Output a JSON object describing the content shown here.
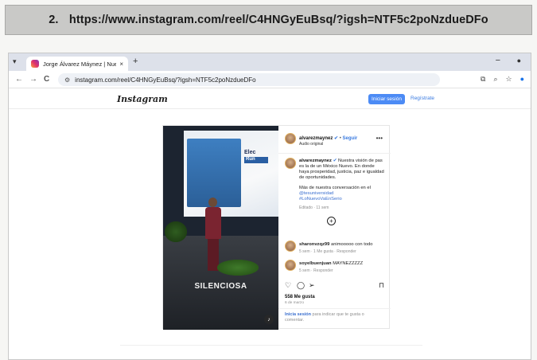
{
  "caption": {
    "number": "2.",
    "url": "https://www.instagram.com/reel/C4HNGyEuBsq/?igsh=NTF5c2poNzdueDFo"
  },
  "browser": {
    "tab_title": "Jorge Álvarez Máynez | Nuevo",
    "tab_close": "×",
    "new_tab": "+",
    "nav_back": "←",
    "nav_forward": "→",
    "nav_reload": "C",
    "address": "instagram.com/reel/C4HNGyEuBsq/?igsh=NTF5c2poNzdueDFo",
    "minimize": "−",
    "more": "●"
  },
  "instagram": {
    "logo": "Instagram",
    "login_button": "Iniciar sesión",
    "register_link": "Regístrate"
  },
  "video": {
    "screen_text_1": "Elec",
    "screen_text_2": "Run",
    "overlay_word": "SILENCIOSA"
  },
  "post": {
    "username": "alvarezmaynez",
    "separator": "•",
    "follow": "Seguir",
    "audio": "Audio original",
    "more_icon": "•••",
    "caption_user": "alvarezmaynez",
    "caption_text": "Nuestra visión de pas es la de un México Nuevo. En donde haya prosperidad, justicia, paz e igualdad de oportunidades.",
    "caption_more": "Más de nuestra conversación en el",
    "tag_1": "@tesuniversidad",
    "tag_2": "#LoNuevoVaEnSerio",
    "edited": "Editado · 11 sem",
    "comments": [
      {
        "user": "sharonvzqz99",
        "text": "animooooo con todo",
        "meta": "5 sem · 1 Me gusta · Responder"
      },
      {
        "user": "soyelbuenjuan",
        "text": "MAYNEZZZZZ",
        "meta": "5 sem · Responder"
      }
    ],
    "likes": "558 Me gusta",
    "date": "6 de marzo",
    "login_prompt_bold": "Inicia sesión",
    "login_prompt_rest": "para indicar que te gusta o comentar."
  }
}
